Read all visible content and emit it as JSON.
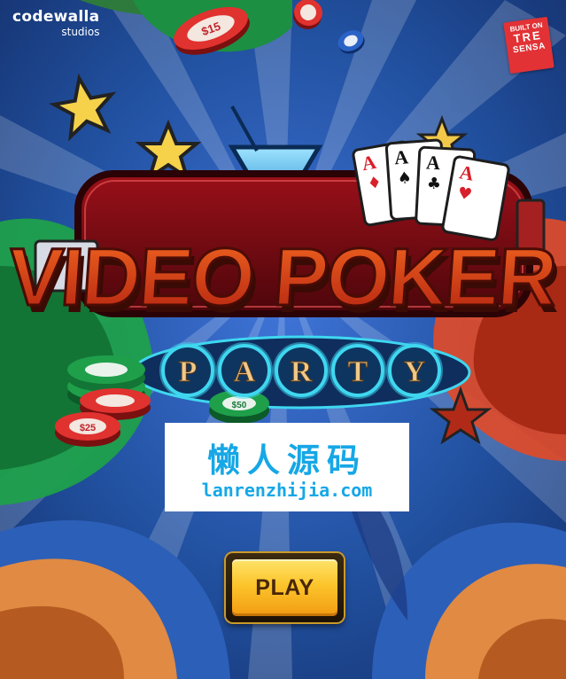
{
  "developer_logo": {
    "name": "codewalla",
    "sub": "studios"
  },
  "platform_badge": {
    "line1": "BUILT ON",
    "line2": "TRE",
    "line3": "SENSA"
  },
  "game_title": {
    "main": "VIDEO POKER",
    "party": [
      "P",
      "A",
      "R",
      "T",
      "Y"
    ]
  },
  "playing_cards": [
    {
      "rank": "A",
      "suit": "♦",
      "color": "#d8202a"
    },
    {
      "rank": "A",
      "suit": "♠",
      "color": "#111111"
    },
    {
      "rank": "A",
      "suit": "♣",
      "color": "#111111"
    },
    {
      "rank": "A",
      "suit": "♥",
      "color": "#d8202a"
    }
  ],
  "chips": [
    {
      "label": "$15",
      "color": "#e0322f"
    },
    {
      "label": "$50",
      "color": "#1f9f4a"
    },
    {
      "label": "$25",
      "color": "#e0322f"
    },
    {
      "label": "$50",
      "color": "#1f9f4a"
    }
  ],
  "watermark": {
    "cn": "懒人源码",
    "url": "lanrenzhijia.com"
  },
  "play_button": {
    "label": "PLAY"
  },
  "colors": {
    "background": "#1b3f8c",
    "title_red": "#d8371a",
    "neon_cyan": "#3fd7f0",
    "button_gold": "#fcc52b"
  }
}
